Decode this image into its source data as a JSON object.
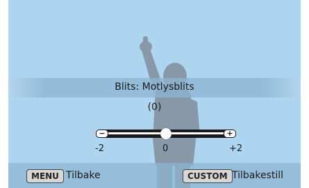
{
  "setting": {
    "title": "Blits: Motlysblits",
    "value_display": "(0)"
  },
  "slider": {
    "min_label": "-2",
    "mid_label": "0",
    "max_label": "+2",
    "value": 0,
    "min": -2,
    "max": 2,
    "minus_icon": "minus-icon",
    "plus_icon": "plus-icon"
  },
  "footer": {
    "menu_key": "MENU",
    "menu_action": "Tilbake",
    "custom_key": "CUSTOM",
    "custom_action": "Tilbakestill"
  },
  "colors": {
    "background": "#aed5ef",
    "silhouette": "#7f94a4",
    "track": "#1a1a1a",
    "knob": "#ffffff"
  }
}
